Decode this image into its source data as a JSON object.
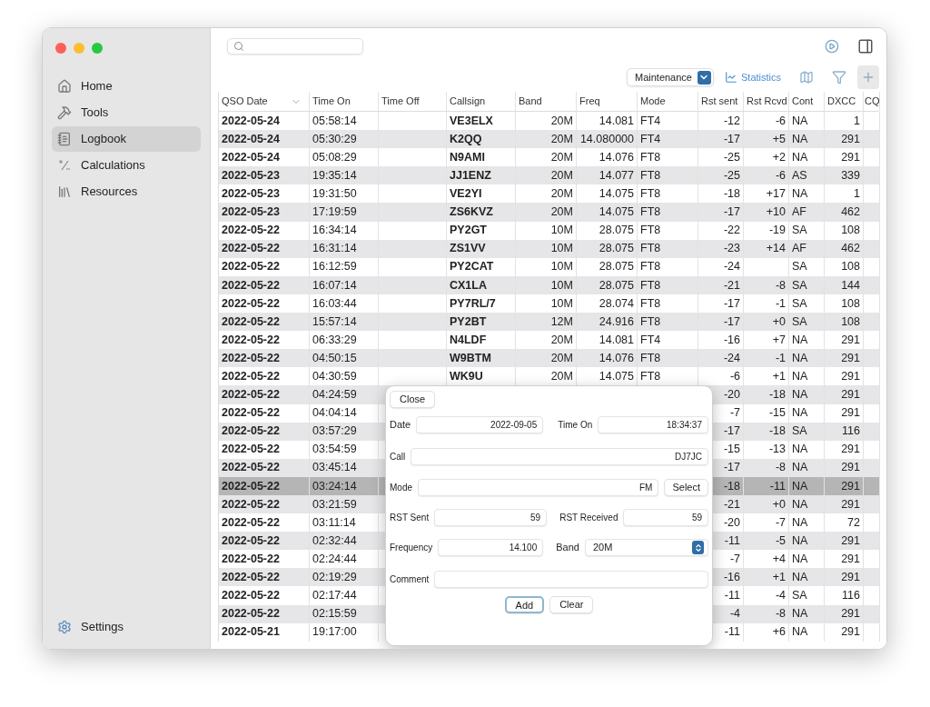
{
  "sidebar": {
    "items": [
      {
        "label": "Home",
        "kind": "home",
        "selected": false
      },
      {
        "label": "Tools",
        "kind": "tools",
        "selected": false
      },
      {
        "label": "Logbook",
        "kind": "logbook",
        "selected": true
      },
      {
        "label": "Calculations",
        "kind": "calculations",
        "selected": false
      },
      {
        "label": "Resources",
        "kind": "resources",
        "selected": false
      }
    ],
    "footer": {
      "label": "Settings"
    }
  },
  "toolbar": {
    "filter_select": {
      "value": "Maintenance"
    },
    "statistics": "Statistics"
  },
  "table": {
    "columns": [
      {
        "label": "QSO Date",
        "sorted": true
      },
      {
        "label": "Time On",
        "sorted": false
      },
      {
        "label": "Time Off",
        "sorted": false
      },
      {
        "label": "Callsign",
        "sorted": false
      },
      {
        "label": "Band",
        "sorted": false
      },
      {
        "label": "Freq",
        "sorted": false
      },
      {
        "label": "Mode",
        "sorted": false
      },
      {
        "label": "Rst sent",
        "sorted": false
      },
      {
        "label": "Rst Rcvd",
        "sorted": false
      },
      {
        "label": "Cont",
        "sorted": false
      },
      {
        "label": "DXCC",
        "sorted": false
      },
      {
        "label": "CQ",
        "sorted": false
      }
    ],
    "rows": [
      {
        "date": "2022-05-24",
        "time_on": "05:58:14",
        "callsign": "VE3ELX",
        "band": "20M",
        "freq": "14.081",
        "mode": "FT4",
        "rst_sent": "-12",
        "rst_rcvd": "-6",
        "cont": "NA",
        "dxcc": "1",
        "selected": false
      },
      {
        "date": "2022-05-24",
        "time_on": "05:30:29",
        "callsign": "K2QQ",
        "band": "20M",
        "freq": "14.080000",
        "mode": "FT4",
        "rst_sent": "-17",
        "rst_rcvd": "+5",
        "cont": "NA",
        "dxcc": "291",
        "selected": false
      },
      {
        "date": "2022-05-24",
        "time_on": "05:08:29",
        "callsign": "N9AMI",
        "band": "20M",
        "freq": "14.076",
        "mode": "FT8",
        "rst_sent": "-25",
        "rst_rcvd": "+2",
        "cont": "NA",
        "dxcc": "291",
        "selected": false
      },
      {
        "date": "2022-05-23",
        "time_on": "19:35:14",
        "callsign": "JJ1ENZ",
        "band": "20M",
        "freq": "14.077",
        "mode": "FT8",
        "rst_sent": "-25",
        "rst_rcvd": "-6",
        "cont": "AS",
        "dxcc": "339",
        "selected": false
      },
      {
        "date": "2022-05-23",
        "time_on": "19:31:50",
        "callsign": "VE2YI",
        "band": "20M",
        "freq": "14.075",
        "mode": "FT8",
        "rst_sent": "-18",
        "rst_rcvd": "+17",
        "cont": "NA",
        "dxcc": "1",
        "selected": false
      },
      {
        "date": "2022-05-23",
        "time_on": "17:19:59",
        "callsign": "ZS6KVZ",
        "band": "20M",
        "freq": "14.075",
        "mode": "FT8",
        "rst_sent": "-17",
        "rst_rcvd": "+10",
        "cont": "AF",
        "dxcc": "462",
        "selected": false
      },
      {
        "date": "2022-05-22",
        "time_on": "16:34:14",
        "callsign": "PY2GT",
        "band": "10M",
        "freq": "28.075",
        "mode": "FT8",
        "rst_sent": "-22",
        "rst_rcvd": "-19",
        "cont": "SA",
        "dxcc": "108",
        "selected": false
      },
      {
        "date": "2022-05-22",
        "time_on": "16:31:14",
        "callsign": "ZS1VV",
        "band": "10M",
        "freq": "28.075",
        "mode": "FT8",
        "rst_sent": "-23",
        "rst_rcvd": "+14",
        "cont": "AF",
        "dxcc": "462",
        "selected": false
      },
      {
        "date": "2022-05-22",
        "time_on": "16:12:59",
        "callsign": "PY2CAT",
        "band": "10M",
        "freq": "28.075",
        "mode": "FT8",
        "rst_sent": "-24",
        "cont": "SA",
        "dxcc": "108",
        "selected": false
      },
      {
        "date": "2022-05-22",
        "time_on": "16:07:14",
        "callsign": "CX1LA",
        "band": "10M",
        "freq": "28.075",
        "mode": "FT8",
        "rst_sent": "-21",
        "rst_rcvd": "-8",
        "cont": "SA",
        "dxcc": "144",
        "selected": false
      },
      {
        "date": "2022-05-22",
        "time_on": "16:03:44",
        "callsign": "PY7RL/7",
        "band": "10M",
        "freq": "28.074",
        "mode": "FT8",
        "rst_sent": "-17",
        "rst_rcvd": "-1",
        "cont": "SA",
        "dxcc": "108",
        "selected": false
      },
      {
        "date": "2022-05-22",
        "time_on": "15:57:14",
        "callsign": "PY2BT",
        "band": "12M",
        "freq": "24.916",
        "mode": "FT8",
        "rst_sent": "-17",
        "rst_rcvd": "+0",
        "cont": "SA",
        "dxcc": "108",
        "selected": false
      },
      {
        "date": "2022-05-22",
        "time_on": "06:33:29",
        "callsign": "N4LDF",
        "band": "20M",
        "freq": "14.081",
        "mode": "FT4",
        "rst_sent": "-16",
        "rst_rcvd": "+7",
        "cont": "NA",
        "dxcc": "291",
        "selected": false
      },
      {
        "date": "2022-05-22",
        "time_on": "04:50:15",
        "callsign": "W9BTM",
        "band": "20M",
        "freq": "14.076",
        "mode": "FT8",
        "rst_sent": "-24",
        "rst_rcvd": "-1",
        "cont": "NA",
        "dxcc": "291",
        "selected": false
      },
      {
        "date": "2022-05-22",
        "time_on": "04:30:59",
        "callsign": "WK9U",
        "band": "20M",
        "freq": "14.075",
        "mode": "FT8",
        "rst_sent": "-6",
        "rst_rcvd": "+1",
        "cont": "NA",
        "dxcc": "291",
        "selected": false
      },
      {
        "date": "2022-05-22",
        "time_on": "04:24:59",
        "rst_sent": "-20",
        "rst_rcvd": "-18",
        "cont": "NA",
        "dxcc": "291",
        "selected": false
      },
      {
        "date": "2022-05-22",
        "time_on": "04:04:14",
        "rst_sent": "-7",
        "rst_rcvd": "-15",
        "cont": "NA",
        "dxcc": "291",
        "selected": false
      },
      {
        "date": "2022-05-22",
        "time_on": "03:57:29",
        "rst_sent": "-17",
        "rst_rcvd": "-18",
        "cont": "SA",
        "dxcc": "116",
        "selected": false
      },
      {
        "date": "2022-05-22",
        "time_on": "03:54:59",
        "rst_sent": "-15",
        "rst_rcvd": "-13",
        "cont": "NA",
        "dxcc": "291",
        "selected": false
      },
      {
        "date": "2022-05-22",
        "time_on": "03:45:14",
        "rst_sent": "-17",
        "rst_rcvd": "-8",
        "cont": "NA",
        "dxcc": "291",
        "selected": false
      },
      {
        "date": "2022-05-22",
        "time_on": "03:24:14",
        "rst_sent": "-18",
        "rst_rcvd": "-11",
        "cont": "NA",
        "dxcc": "291",
        "selected": true
      },
      {
        "date": "2022-05-22",
        "time_on": "03:21:59",
        "rst_sent": "-21",
        "rst_rcvd": "+0",
        "cont": "NA",
        "dxcc": "291",
        "selected": false
      },
      {
        "date": "2022-05-22",
        "time_on": "03:11:14",
        "rst_sent": "-20",
        "rst_rcvd": "-7",
        "cont": "NA",
        "dxcc": "72",
        "selected": false
      },
      {
        "date": "2022-05-22",
        "time_on": "02:32:44",
        "rst_sent": "-11",
        "rst_rcvd": "-5",
        "cont": "NA",
        "dxcc": "291",
        "selected": false
      },
      {
        "date": "2022-05-22",
        "time_on": "02:24:44",
        "rst_sent": "-7",
        "rst_rcvd": "+4",
        "cont": "NA",
        "dxcc": "291",
        "selected": false
      },
      {
        "date": "2022-05-22",
        "time_on": "02:19:29",
        "rst_sent": "-16",
        "rst_rcvd": "+1",
        "cont": "NA",
        "dxcc": "291",
        "selected": false
      },
      {
        "date": "2022-05-22",
        "time_on": "02:17:44",
        "rst_sent": "-11",
        "rst_rcvd": "-4",
        "cont": "SA",
        "dxcc": "116",
        "selected": false
      },
      {
        "date": "2022-05-22",
        "time_on": "02:15:59",
        "rst_sent": "-4",
        "rst_rcvd": "-8",
        "cont": "NA",
        "dxcc": "291",
        "selected": false
      },
      {
        "date": "2022-05-21",
        "time_on": "19:17:00",
        "rst_sent": "-11",
        "rst_rcvd": "+6",
        "cont": "NA",
        "dxcc": "291",
        "selected": false
      }
    ]
  },
  "popover": {
    "close": "Close",
    "date": {
      "label": "Date",
      "value": "2022-09-05"
    },
    "time_on": {
      "label": "Time On",
      "value": "18:34:37"
    },
    "call": {
      "label": "Call",
      "value": "DJ7JC"
    },
    "mode": {
      "label": "Mode",
      "value": "FM",
      "button": "Select"
    },
    "rst_sent": {
      "label": "RST Sent",
      "value": "59"
    },
    "rst_received": {
      "label": "RST Received",
      "value": "59"
    },
    "frequency": {
      "label": "Frequency",
      "value": "14.100"
    },
    "band": {
      "label": "Band",
      "value": "20M"
    },
    "comment": {
      "label": "Comment"
    },
    "buttons": [
      {
        "label": "Add",
        "default": true
      },
      {
        "label": "Clear",
        "default": false
      }
    ]
  }
}
